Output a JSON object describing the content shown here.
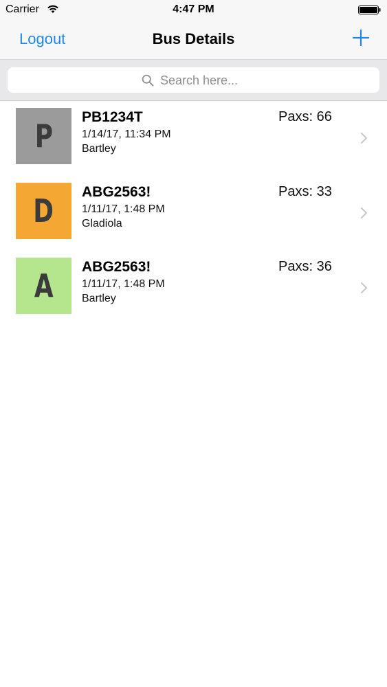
{
  "status_bar": {
    "carrier": "Carrier",
    "time": "4:47 PM",
    "icons": [
      "wifi-icon",
      "battery-icon"
    ]
  },
  "nav": {
    "left_button": "Logout",
    "title": "Bus Details",
    "right_icon": "add-icon",
    "accent_color": "#1f87e8"
  },
  "search": {
    "placeholder": "Search here...",
    "value": ""
  },
  "buses": [
    {
      "letter": "P",
      "color": "#9b9b9b",
      "id": "PB1234T",
      "date": "1/14/17, 11:34 PM",
      "name": "Bartley",
      "paxs": "Paxs: 66"
    },
    {
      "letter": "D",
      "color": "#f5a733",
      "id": "ABG2563!",
      "date": "1/11/17, 1:48 PM",
      "name": "Gladiola",
      "paxs": "Paxs: 33"
    },
    {
      "letter": "A",
      "color": "#b5e68d",
      "id": "ABG2563!",
      "date": "1/11/17, 1:48 PM",
      "name": "Bartley",
      "paxs": "Paxs: 36"
    }
  ]
}
